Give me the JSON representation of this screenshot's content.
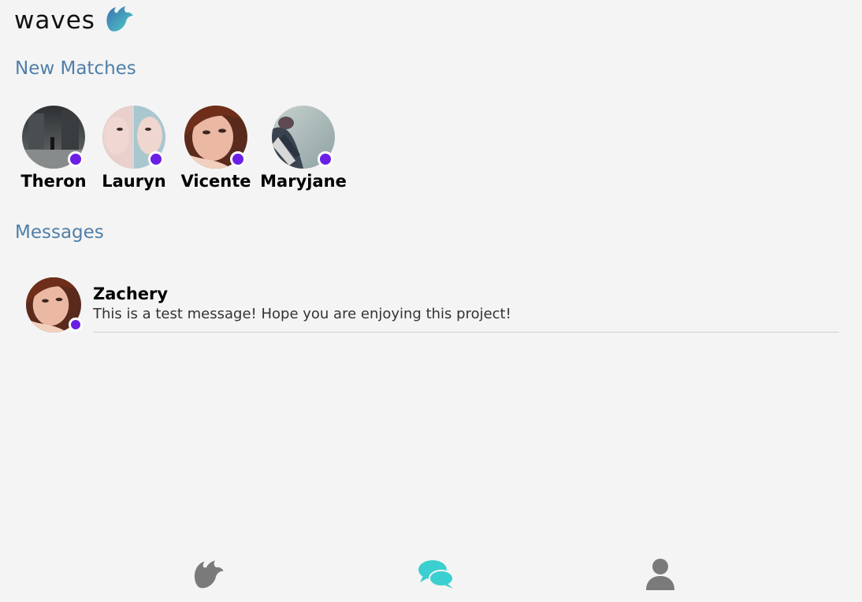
{
  "brand": {
    "name": "waves",
    "logo_icon": "waves-logo-icon"
  },
  "sections": {
    "new_matches": "New Matches",
    "messages": "Messages"
  },
  "matches": [
    {
      "name": "Theron",
      "avatar_icon": "profile-photo"
    },
    {
      "name": "Lauryn",
      "avatar_icon": "profile-photo"
    },
    {
      "name": "Vicente",
      "avatar_icon": "profile-photo"
    },
    {
      "name": "Maryjane",
      "avatar_icon": "profile-photo"
    }
  ],
  "conversations": [
    {
      "name": "Zachery",
      "preview": "This is a test message! Hope you are enjoying this project!"
    }
  ],
  "nav": {
    "items": [
      {
        "icon": "waves-icon",
        "active": false
      },
      {
        "icon": "chat-bubbles-icon",
        "active": true
      },
      {
        "icon": "user-icon",
        "active": false
      }
    ]
  },
  "colors": {
    "accent": "#4f7fa8",
    "online_dot": "#6b1fe6",
    "active_nav": "#3ccfcf",
    "inactive_nav": "#7a7a7a"
  }
}
